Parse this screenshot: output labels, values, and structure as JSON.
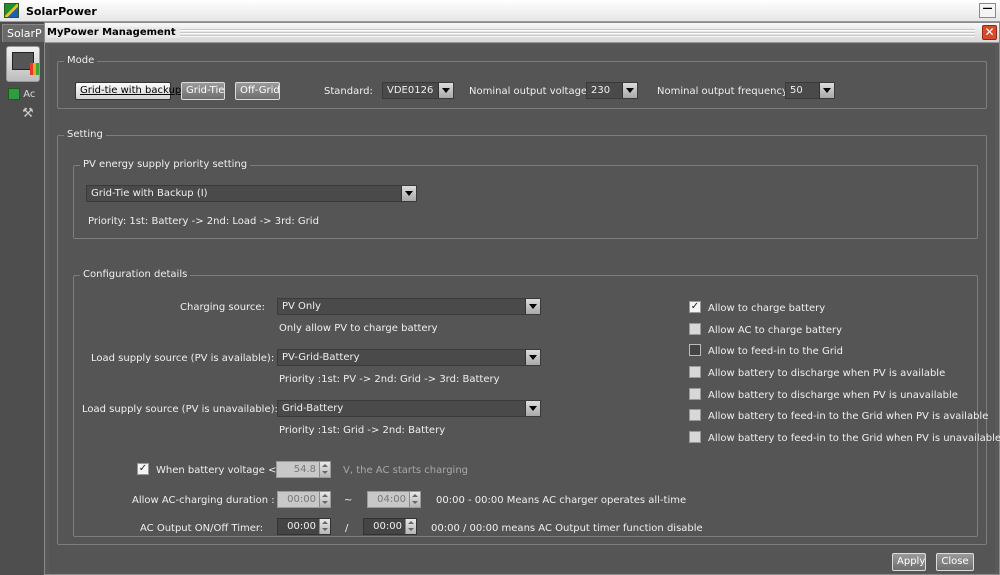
{
  "app": {
    "title": "SolarPower",
    "tab_label": "SolarP",
    "side_item_label": "Ac",
    "minimize_glyph": "—"
  },
  "dialog": {
    "title": "MyPower Management",
    "close_glyph": "✕"
  },
  "mode": {
    "legend": "Mode",
    "buttons": [
      "Grid-tie with backup",
      "Grid-Tie",
      "Off-Grid"
    ],
    "selected_button": "Grid-tie with backup",
    "standard_label": "Standard:",
    "standard_value": "VDE0126",
    "voltage_label": "Nominal output voltage:",
    "voltage_value": "230",
    "frequency_label": "Nominal output frequency:",
    "frequency_value": "50"
  },
  "setting": {
    "legend": "Setting",
    "pv_priority": {
      "legend": "PV energy supply priority setting",
      "value": "Grid-Tie with Backup (I)",
      "priority_text": "Priority: 1st: Battery -> 2nd: Load -> 3rd: Grid"
    },
    "config": {
      "legend": "Configuration details",
      "charging_source": {
        "label": "Charging source:",
        "value": "PV Only",
        "hint": "Only allow PV to charge battery"
      },
      "load_pv_available": {
        "label": "Load supply source (PV is available):",
        "value": "PV-Grid-Battery",
        "hint": "Priority :1st: PV -> 2nd: Grid -> 3rd: Battery"
      },
      "load_pv_unavailable": {
        "label": "Load supply source (PV is unavailable):",
        "value": "Grid-Battery",
        "hint": "Priority :1st: Grid -> 2nd: Battery"
      },
      "battery_voltage": {
        "label": "When battery voltage <",
        "checked": true,
        "value": "54.8",
        "suffix": "V,   the AC starts charging"
      },
      "ac_charging_duration": {
        "label": "Allow AC-charging duration :",
        "from": "00:00",
        "separator": "~",
        "to": "04:00",
        "note": "00:00 - 00:00 Means AC charger operates all-time"
      },
      "ac_output_timer": {
        "label": "AC Output ON/Off Timer:",
        "from": "00:00",
        "separator": "/",
        "to": "00:00",
        "note": "00:00 / 00:00 means AC Output timer function disable"
      },
      "options": [
        {
          "label": "Allow to charge battery",
          "checked": true,
          "enabled": true
        },
        {
          "label": "Allow AC to charge battery",
          "checked": false,
          "enabled": true
        },
        {
          "label": "Allow to feed-in to the Grid",
          "checked": false,
          "enabled": true
        },
        {
          "label": "Allow battery to discharge when PV is available",
          "checked": false,
          "enabled": true
        },
        {
          "label": "Allow battery to discharge when PV is unavailable",
          "checked": false,
          "enabled": true
        },
        {
          "label": "Allow battery to feed-in to the Grid when PV is available",
          "checked": false,
          "enabled": true
        },
        {
          "label": "Allow battery to feed-in to the Grid when PV is unavailable",
          "checked": false,
          "enabled": true
        }
      ],
      "check_glyph": "✓"
    }
  },
  "footer": {
    "apply_label": "Apply",
    "close_label": "Close"
  }
}
